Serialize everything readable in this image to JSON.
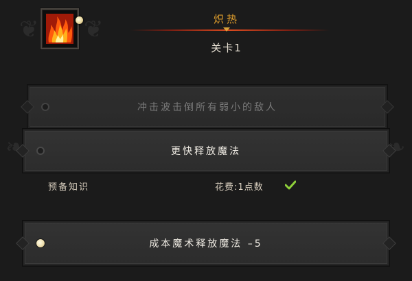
{
  "header": {
    "title": "炽热",
    "level": "关卡1",
    "icon": "fire-icon"
  },
  "options": [
    {
      "label": "冲击波击倒所有弱小的敌人",
      "state": "disabled"
    },
    {
      "label": "更快释放魔法",
      "state": "default"
    },
    {
      "label": "成本魔术释放魔法 –5",
      "state": "selected"
    }
  ],
  "requirements": {
    "prereq_label": "预备知识",
    "cost_label": "花费:1点数",
    "cost_met": true
  },
  "colors": {
    "title": "#e3a02d",
    "divider": "#d84a1f",
    "check": "#8fd13a"
  }
}
